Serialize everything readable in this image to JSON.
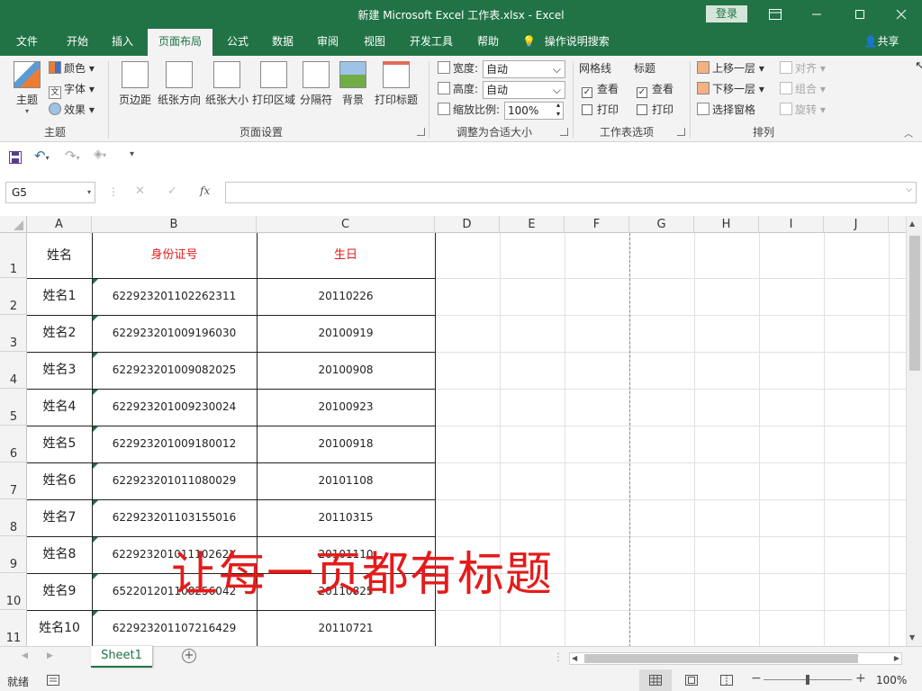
{
  "window": {
    "title": "新建 Microsoft Excel 工作表.xlsx  -  Excel",
    "login_label": "登录"
  },
  "menu": {
    "tabs": [
      "文件",
      "开始",
      "插入",
      "页面布局",
      "公式",
      "数据",
      "审阅",
      "视图",
      "开发工具",
      "帮助"
    ],
    "active_tab": "页面布局",
    "tell_me": "操作说明搜索",
    "share": "共享"
  },
  "ribbon": {
    "themes": {
      "label": "主题",
      "themes_btn": "主题",
      "colors": "颜色",
      "fonts": "字体",
      "effects": "效果"
    },
    "page_setup": {
      "label": "页面设置",
      "buttons": [
        "页边距",
        "纸张方向",
        "纸张大小",
        "打印区域",
        "分隔符",
        "背景",
        "打印标题"
      ]
    },
    "scale": {
      "label": "调整为合适大小",
      "width_label": "宽度:",
      "width_value": "自动",
      "height_label": "高度:",
      "height_value": "自动",
      "scale_label": "缩放比例:",
      "scale_value": "100%"
    },
    "sheet_options": {
      "label": "工作表选项",
      "gridlines": "网格线",
      "headings": "标题",
      "view": "查看",
      "print": "打印"
    },
    "arrange": {
      "label": "排列",
      "bring_forward": "上移一层",
      "send_backward": "下移一层",
      "selection_pane": "选择窗格",
      "align": "对齐",
      "group": "组合",
      "rotate": "旋转"
    }
  },
  "formula": {
    "namebox": "G5",
    "fx": "fx",
    "value": ""
  },
  "sheet": {
    "columns": [
      "A",
      "B",
      "C",
      "D",
      "E",
      "F",
      "G",
      "H",
      "I",
      "J"
    ],
    "row_numbers": [
      "1",
      "2",
      "3",
      "4",
      "5",
      "6",
      "7",
      "8",
      "9",
      "10",
      "11"
    ],
    "header": [
      "姓名",
      "身份证号",
      "生日"
    ],
    "rows": [
      [
        "姓名1",
        "622923201102262311",
        "20110226"
      ],
      [
        "姓名2",
        "622923201009196030",
        "20100919"
      ],
      [
        "姓名3",
        "622923201009082025",
        "20100908"
      ],
      [
        "姓名4",
        "622923201009230024",
        "20100923"
      ],
      [
        "姓名5",
        "622923201009180012",
        "20100918"
      ],
      [
        "姓名6",
        "622923201011080029",
        "20101108"
      ],
      [
        "姓名7",
        "622923201103155016",
        "20110315"
      ],
      [
        "姓名8",
        "62292320101110262X",
        "20101110"
      ],
      [
        "姓名9",
        "652201201108256042",
        "20110825"
      ],
      [
        "姓名10",
        "622923201107216429",
        "20110721"
      ]
    ],
    "overlay_text": "让每一页都有标题",
    "header_color": "#e41b1b"
  },
  "tabs": {
    "sheet_name": "Sheet1"
  },
  "status": {
    "ready": "就绪",
    "zoom": "100%"
  }
}
